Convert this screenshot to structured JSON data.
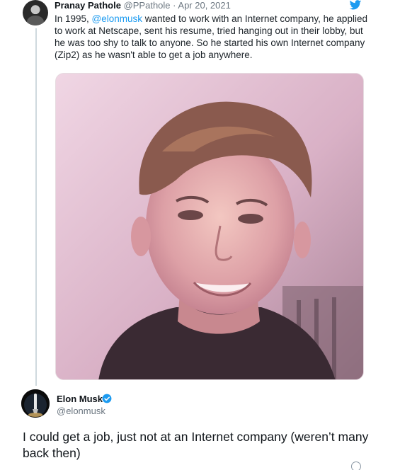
{
  "tweet1": {
    "author_name": "Pranay Pathole",
    "author_handle": "@PPathole",
    "separator": "·",
    "date": "Apr 20, 2021",
    "text_before_mention": "In 1995, ",
    "mention": "@elonmusk",
    "text_after_mention": " wanted to work with an Internet company, he applied to work at Netscape, sent his resume, tried hanging out in their lobby, but he was too shy to talk to anyone. So he started his own Internet company (Zip2) as he wasn't able to get a job anywhere."
  },
  "tweet2": {
    "author_name": "Elon Musk",
    "author_handle": "@elonmusk",
    "text": "I could get a job, just not at an Internet company (weren’t many back then)"
  },
  "colors": {
    "accent": "#1d9bf0",
    "muted": "#6b7680",
    "thread_line": "#cfd9de"
  },
  "icons": {
    "logo": "twitter-bird-icon",
    "verified": "verified-badge-icon"
  }
}
